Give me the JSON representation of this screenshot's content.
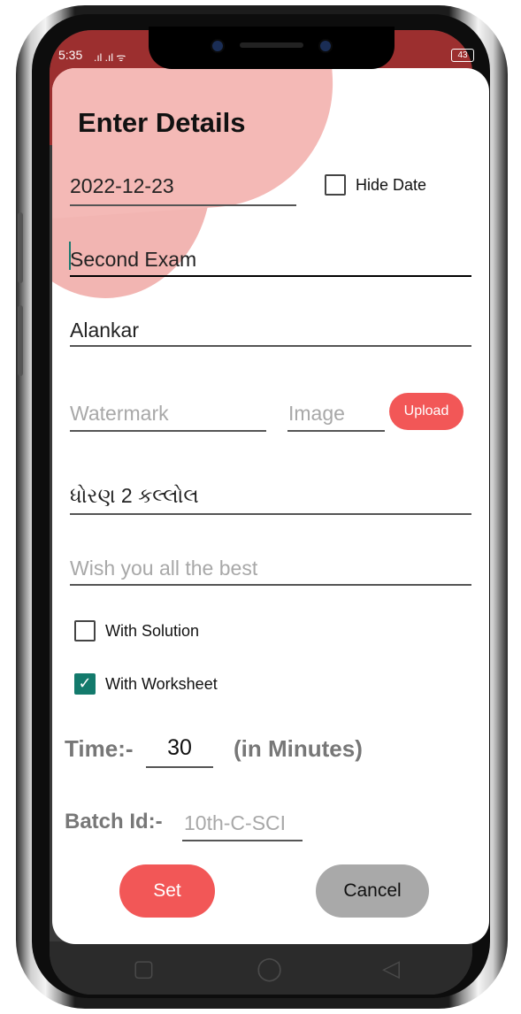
{
  "status_bar": {
    "time": "5:35",
    "signal": ".ıl .ıl ᯤ",
    "battery": "43"
  },
  "dialog": {
    "title": "Enter Details",
    "date_value": "2022-12-23",
    "hide_date_label": "Hide Date",
    "exam_name": "Second Exam",
    "institute_name": "Alankar",
    "watermark_placeholder": "Watermark",
    "image_placeholder": "Image",
    "upload_label": "Upload",
    "class_name": "ધોરણ 2 કલ્લોલ",
    "wish_placeholder": "Wish you all the best",
    "with_solution_label": "With Solution",
    "with_solution_checked": false,
    "with_worksheet_label": "With Worksheet",
    "with_worksheet_checked": true,
    "time_label": "Time:-",
    "time_value": "30",
    "time_unit": "(in Minutes)",
    "batch_label": "Batch Id:-",
    "batch_placeholder": "10th-C-SCI",
    "set_label": "Set",
    "cancel_label": "Cancel",
    "checkmark_icon": "✓"
  },
  "nav": {
    "recents_icon": "▢",
    "home_icon": "◯",
    "back_icon": "◁"
  },
  "colors": {
    "accent": "#f25757",
    "checkbox_checked": "#137a6c",
    "cancel_button": "#a9a9a9"
  }
}
